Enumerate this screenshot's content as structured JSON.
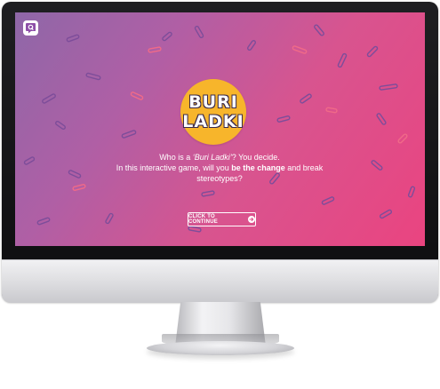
{
  "app": {
    "brand_logo_letter": "Q"
  },
  "badge": {
    "line1": "BURI",
    "line2": "LADKI"
  },
  "intro": {
    "part1": "Who is a ",
    "em_term": "‘Buri Ladki’",
    "part2": "? You decide.",
    "part3": "In this interactive game, will you ",
    "bold_phrase": "be the change",
    "part4": " and break stereotypes?"
  },
  "cta": {
    "label": "CLICK TO CONTINUE",
    "icon": "arrow-right-circle-icon"
  },
  "colors": {
    "gradient_start": "#8e67a8",
    "gradient_end": "#ea4480",
    "badge": "#f7b52b",
    "confetti": "#7d4d9a",
    "confetti_alt": "#f06a88"
  }
}
